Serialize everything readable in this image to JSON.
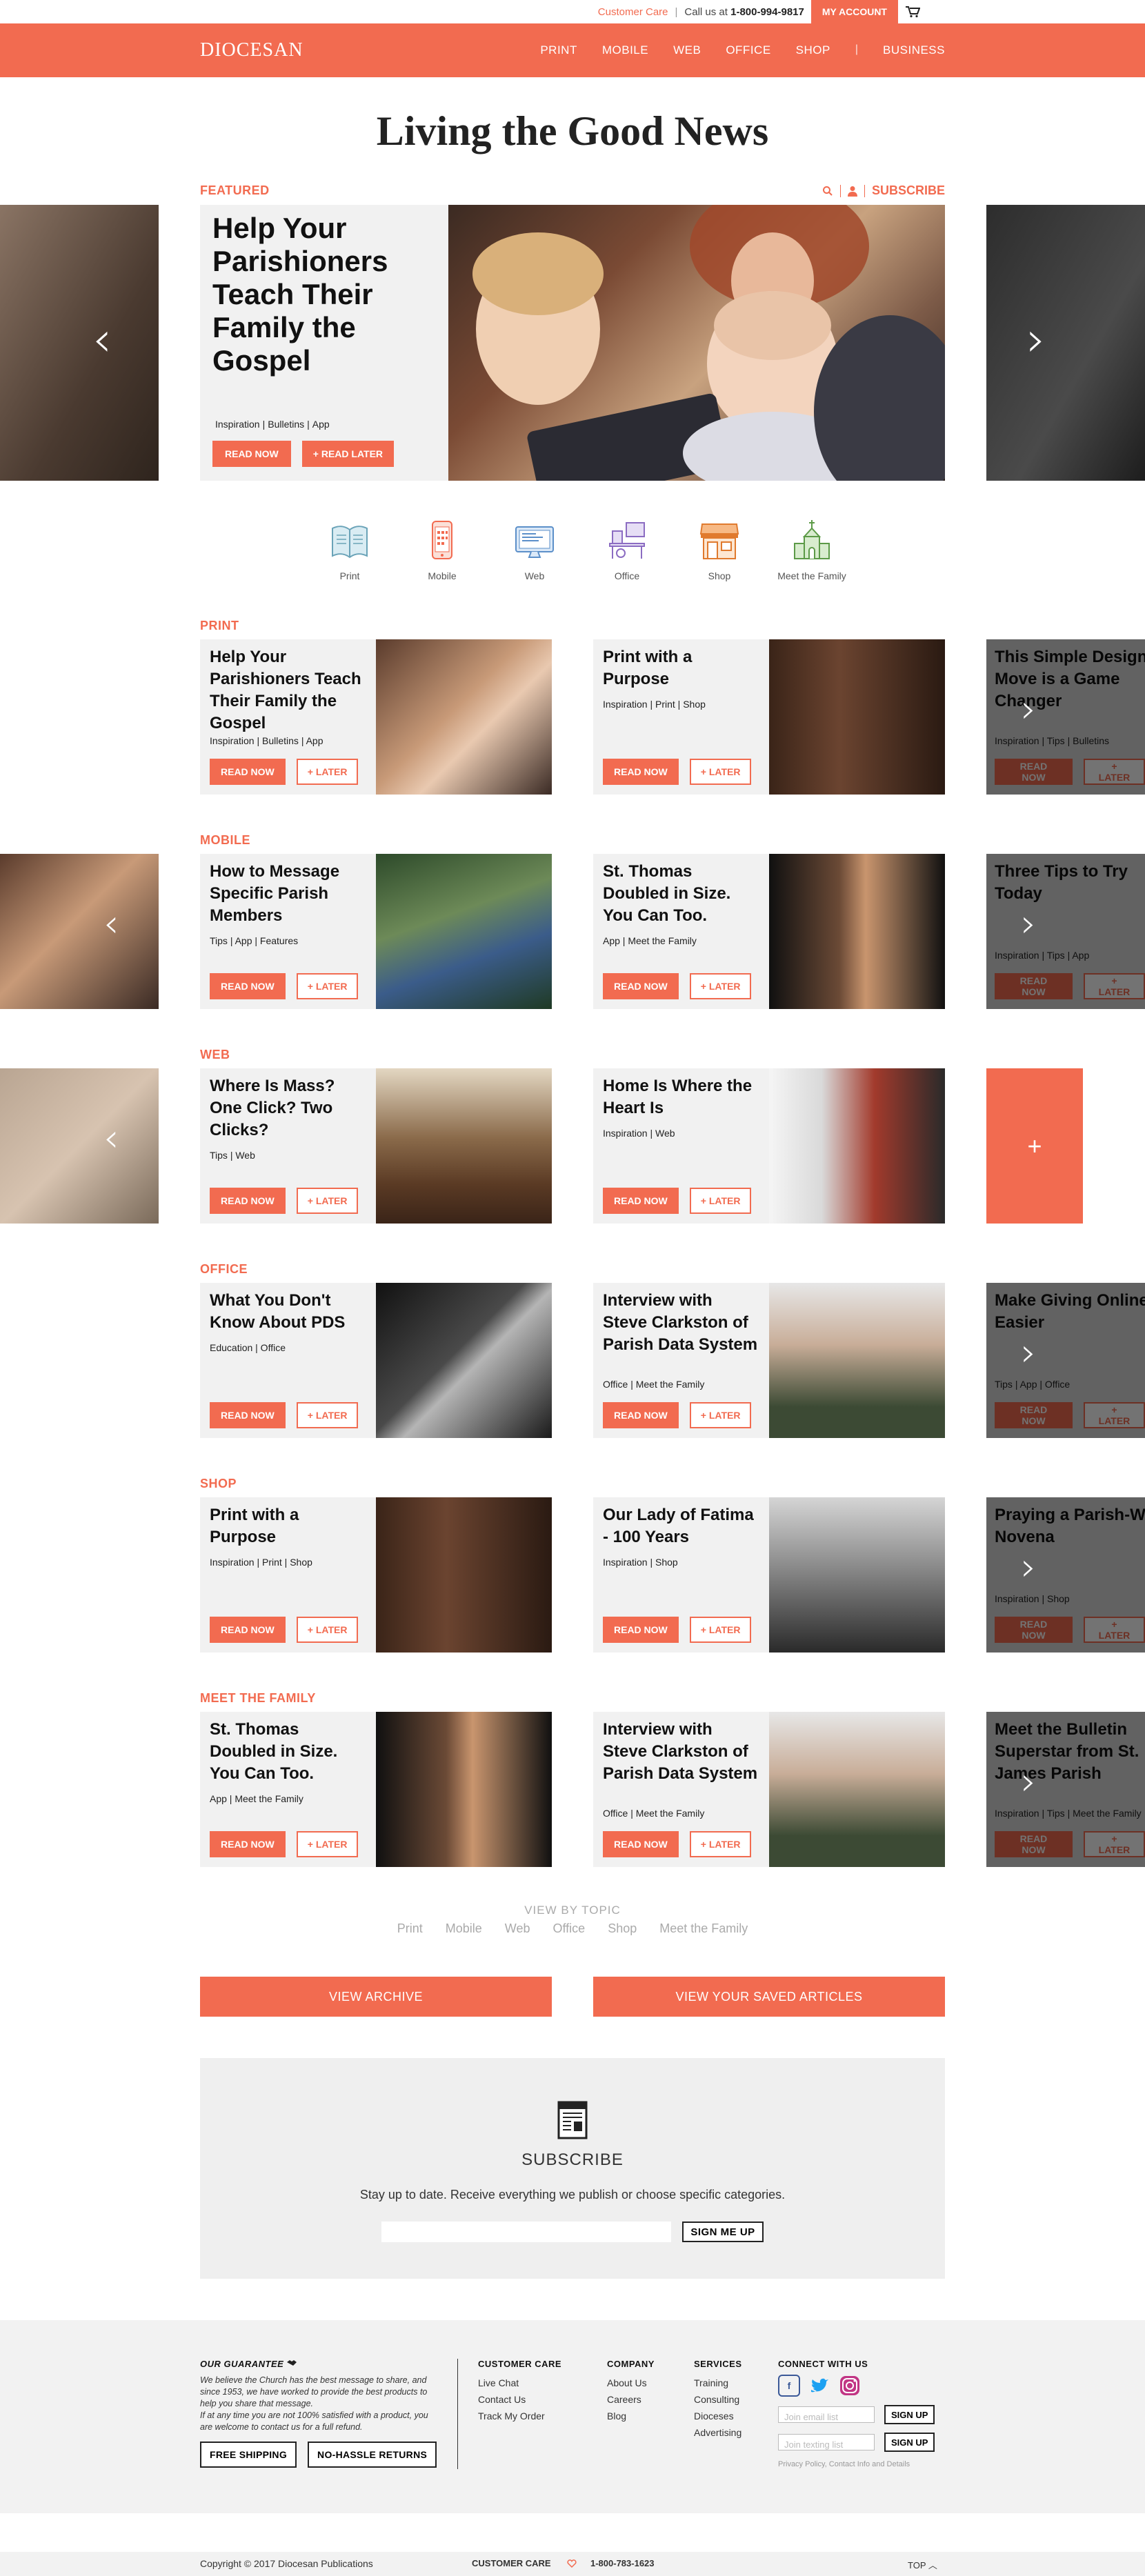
{
  "topbar": {
    "customer_care": "Customer Care",
    "call_prefix": "Call us at",
    "phone": "1-800-994-9817",
    "my_account": "MY ACCOUNT"
  },
  "header": {
    "logo": "DIOCESAN",
    "nav": [
      "PRINT",
      "MOBILE",
      "WEB",
      "OFFICE",
      "SHOP",
      "BUSINESS"
    ]
  },
  "page_title": "Living the Good News",
  "featured": {
    "label": "FEATURED",
    "subscribe": "SUBSCRIBE",
    "title": "Help Your Parishioners Teach Their Family the Gospel",
    "tags": [
      "Inspiration",
      "Bulletins",
      "App"
    ],
    "read_now": "READ NOW",
    "read_later": "+ READ LATER"
  },
  "topics": [
    "Print",
    "Mobile",
    "Web",
    "Office",
    "Shop",
    "Meet the Family"
  ],
  "buttons": {
    "read_now": "READ NOW",
    "later": "+ LATER"
  },
  "sections": [
    {
      "label": "PRINT",
      "cards": [
        {
          "title": "Help Your Parishioners Teach Their Family the Gospel",
          "tags": "Inspiration  |  Bulletins  |  App"
        },
        {
          "title": "Print with a Purpose",
          "tags": "Inspiration  |  Print  |  Shop"
        }
      ],
      "peek": {
        "title": "This Simple Design Move is a Game Changer",
        "tags": "Inspiration  |  Tips  |  Bulletins"
      }
    },
    {
      "label": "MOBILE",
      "cards": [
        {
          "title": "How to Message Specific Parish Members",
          "tags": "Tips  |  App  |  Features"
        },
        {
          "title": "St. Thomas Doubled in Size. You Can Too.",
          "tags": "App  |  Meet the Family"
        }
      ],
      "peek": {
        "title": "Three Tips to Try Today",
        "tags": "Inspiration  |  Tips  |  App"
      }
    },
    {
      "label": "WEB",
      "cards": [
        {
          "title": "Where Is Mass? One Click? Two Clicks?",
          "tags": "Tips  |  Web"
        },
        {
          "title": "Home Is Where the Heart Is",
          "tags": "Inspiration  |  Web"
        }
      ],
      "peek": {
        "title": "+",
        "tags": ""
      }
    },
    {
      "label": "OFFICE",
      "cards": [
        {
          "title": "What You Don't Know About PDS",
          "tags": "Education  |  Office"
        },
        {
          "title": "Interview with Steve Clarkston of Parish Data System",
          "tags": "Office  |  Meet the Family"
        }
      ],
      "peek": {
        "title": "Make Giving Online Easier",
        "tags": "Tips  |  App  |  Office"
      }
    },
    {
      "label": "SHOP",
      "cards": [
        {
          "title": "Print with a Purpose",
          "tags": "Inspiration  |  Print  |  Shop"
        },
        {
          "title": "Our Lady of Fatima - 100 Years",
          "tags": "Inspiration  |  Shop"
        }
      ],
      "peek": {
        "title": "Praying a Parish-Wide Novena",
        "tags": "Inspiration  |  Shop"
      }
    },
    {
      "label": "MEET THE FAMILY",
      "cards": [
        {
          "title": "St. Thomas Doubled in Size. You Can Too.",
          "tags": "App  |  Meet the Family"
        },
        {
          "title": "Interview with Steve Clarkston of Parish Data System",
          "tags": "Office  |  Meet the Family"
        }
      ],
      "peek": {
        "title": "Meet the Bulletin Superstar from St. James Parish",
        "tags": "Inspiration  |  Tips  |  Meet the Family"
      }
    }
  ],
  "view_by_topic": {
    "label": "VIEW BY TOPIC",
    "links": [
      "Print",
      "Mobile",
      "Web",
      "Office",
      "Shop",
      "Meet the Family"
    ]
  },
  "view_archive": "VIEW ARCHIVE",
  "view_saved": "VIEW YOUR SAVED ARTICLES",
  "subscribe_box": {
    "title": "SUBSCRIBE",
    "desc": "Stay up to date. Receive everything we publish or choose specific categories.",
    "button": "SIGN ME UP"
  },
  "footer": {
    "guarantee_title": "OUR GUARANTEE",
    "guarantee_text": "We believe the Church has the best message to share, and since 1953, we have worked to provide the best products to help you share that message.",
    "guarantee_text2": "If at any time you are not 100% satisfied with a product, you are welcome to contact us for a full refund.",
    "free_shipping": "FREE SHIPPING",
    "no_hassle": "NO-HASSLE RETURNS",
    "customer_care": {
      "title": "CUSTOMER CARE",
      "links": [
        "Live Chat",
        "Contact Us",
        "Track My Order"
      ]
    },
    "company": {
      "title": "COMPANY",
      "links": [
        "About Us",
        "Careers",
        "Blog"
      ]
    },
    "services": {
      "title": "SERVICES",
      "links": [
        "Training",
        "Consulting",
        "Dioceses",
        "Advertising"
      ]
    },
    "connect": {
      "title": "CONNECT WITH US",
      "email_placeholder": "Join email list",
      "text_placeholder": "Join texting list",
      "sign_up": "SIGN UP",
      "privacy": "Privacy Policy, Contact Info and Details"
    }
  },
  "bottombar": {
    "copyright": "Copyright © 2017 Diocesan Publications",
    "customer_care": "CUSTOMER CARE",
    "phone": "1-800-783-1623",
    "top": "TOP"
  },
  "colors": {
    "accent": "#f26b50"
  }
}
